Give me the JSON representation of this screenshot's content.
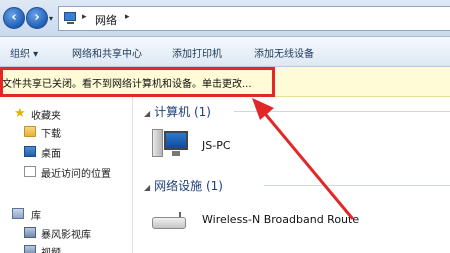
{
  "address_bar": {
    "path": "网络",
    "back_icon": "arrow-left-icon",
    "forward_icon": "arrow-right-icon"
  },
  "toolbar": {
    "organize": "组织 ▾",
    "network_center": "网络和共享中心",
    "add_printer": "添加打印机",
    "add_wireless": "添加无线设备"
  },
  "infobar": {
    "message": "文件共享已关闭。看不到网络计算机和设备。单击更改..."
  },
  "nav": {
    "items": [
      {
        "label": "收藏夹",
        "icon": "star-icon"
      },
      {
        "label": "下载",
        "icon": "folder-icon"
      },
      {
        "label": "桌面",
        "icon": "desktop-icon"
      },
      {
        "label": "最近访问的位置",
        "icon": "recent-places-icon"
      },
      {
        "label": "库",
        "icon": "library-icon"
      },
      {
        "label": "暴风影视库",
        "icon": "video-library-icon"
      },
      {
        "label": "视频",
        "icon": "video-icon"
      }
    ]
  },
  "content": {
    "groups": [
      {
        "header": "计算机 (1)",
        "items": [
          {
            "label": "JS-PC",
            "icon": "computer-icon"
          }
        ]
      },
      {
        "header": "网络设施 (1)",
        "items": [
          {
            "label": "Wireless-N Broadband Route",
            "icon": "router-icon"
          }
        ]
      }
    ]
  },
  "colors": {
    "annotation_red": "#e32626",
    "infobar_bg": "#fffbd6",
    "group_header": "#1e3f7a"
  }
}
